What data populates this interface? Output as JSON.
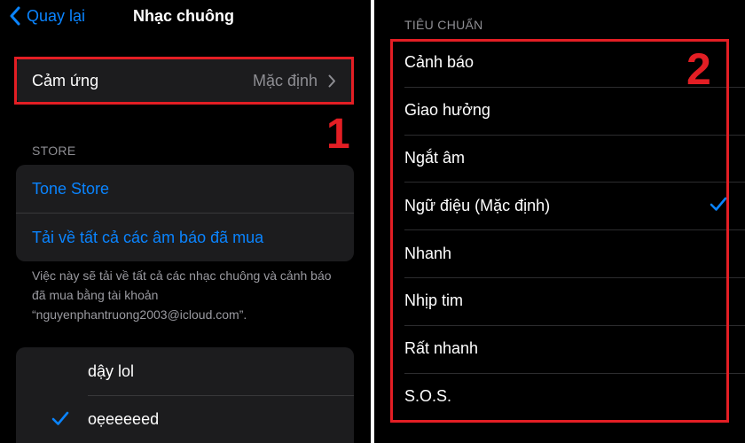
{
  "left": {
    "nav": {
      "back_label": "Quay lại",
      "title": "Nhạc chuông"
    },
    "haptics": {
      "label": "Cảm ứng",
      "value": "Mặc định"
    },
    "store": {
      "header": "STORE",
      "tone_store": "Tone Store",
      "download_all": "Tải về tất cả các âm báo đã mua",
      "footer": "Việc này sẽ tải về tất cả các nhạc chuông và cảnh báo đã mua bằng tài khoản “nguyenphantruong2003@icloud.com”."
    },
    "tones": [
      {
        "label": "dậy lol",
        "selected": false
      },
      {
        "label": "oẹeeeeed",
        "selected": true
      }
    ],
    "marker": "1"
  },
  "right": {
    "header": "TIÊU CHUẨN",
    "items": [
      {
        "label": "Cảnh báo",
        "selected": false
      },
      {
        "label": "Giao hưởng",
        "selected": false
      },
      {
        "label": "Ngắt âm",
        "selected": false
      },
      {
        "label": "Ngữ điệu (Mặc định)",
        "selected": true
      },
      {
        "label": "Nhanh",
        "selected": false
      },
      {
        "label": "Nhịp tim",
        "selected": false
      },
      {
        "label": "Rất nhanh",
        "selected": false
      },
      {
        "label": "S.O.S.",
        "selected": false
      }
    ],
    "marker": "2"
  },
  "colors": {
    "accent": "#0a84ff",
    "highlight": "#e31e24",
    "background": "#000000",
    "cell": "#1c1c1e",
    "secondary_text": "#8e8e93"
  },
  "icons": [
    "chevron-left-icon",
    "chevron-right-icon",
    "checkmark-icon"
  ]
}
